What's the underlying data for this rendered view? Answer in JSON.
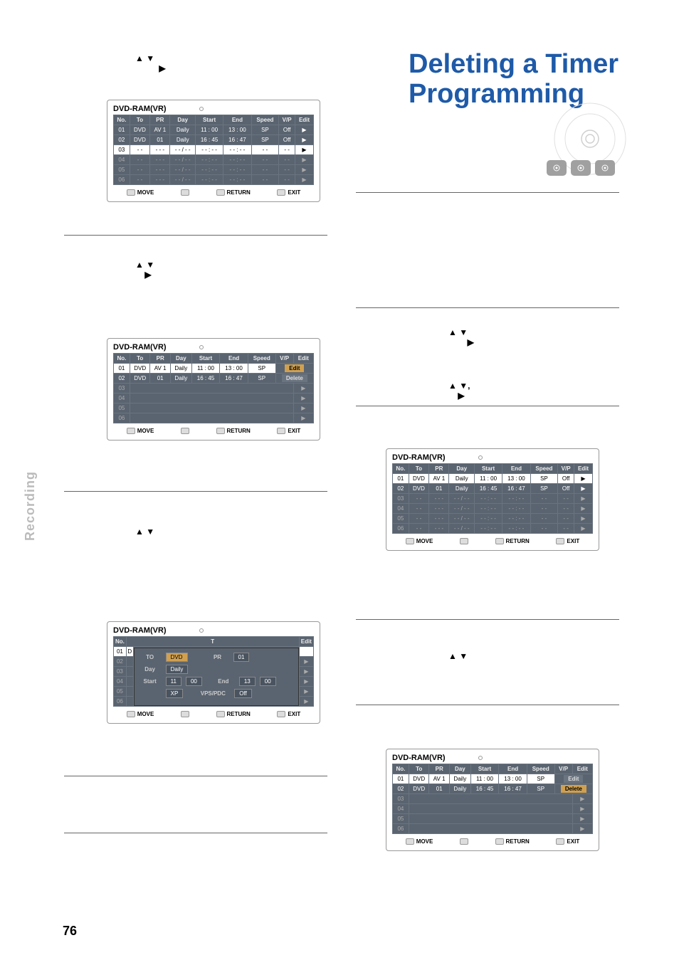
{
  "page_number": "76",
  "side_label": "Recording",
  "title_line1": "Deleting a Timer",
  "title_line2": "Programming",
  "panel_label": "DVD-RAM(VR)",
  "headers": [
    "No.",
    "To",
    "PR",
    "Day",
    "Start",
    "End",
    "Speed",
    "V/P",
    "Edit"
  ],
  "row1": [
    "01",
    "DVD",
    "AV 1",
    "Daily",
    "11 : 00",
    "13 : 00",
    "SP",
    "Off",
    "▶"
  ],
  "row2": [
    "02",
    "DVD",
    "01",
    "Daily",
    "16 : 45",
    "16 : 47",
    "SP",
    "Off",
    "▶"
  ],
  "row_empty": [
    "- -",
    "- - -",
    "- - / - -",
    "- - : - -",
    "- - : - -",
    "- -",
    "- -",
    "▶"
  ],
  "footer": {
    "move": "MOVE",
    "select": "",
    "return": "RETURN",
    "exit": "EXIT"
  },
  "menu": {
    "edit": "Edit",
    "delete": "Delete"
  },
  "popup": {
    "to": "TO",
    "to_v": "DVD",
    "pr": "PR",
    "pr_v": "01",
    "day": "Day",
    "day_v": "Daily",
    "start": "Start",
    "start_h": "11",
    "start_m": "00",
    "end": "End",
    "end_h": "13",
    "end_m": "00",
    "xp": "XP",
    "vps": "VPS/PDC",
    "vps_v": "Off"
  },
  "arrows": {
    "ud": "▲ ▼",
    "r": "▶",
    "udc": "▲ ▼,"
  }
}
